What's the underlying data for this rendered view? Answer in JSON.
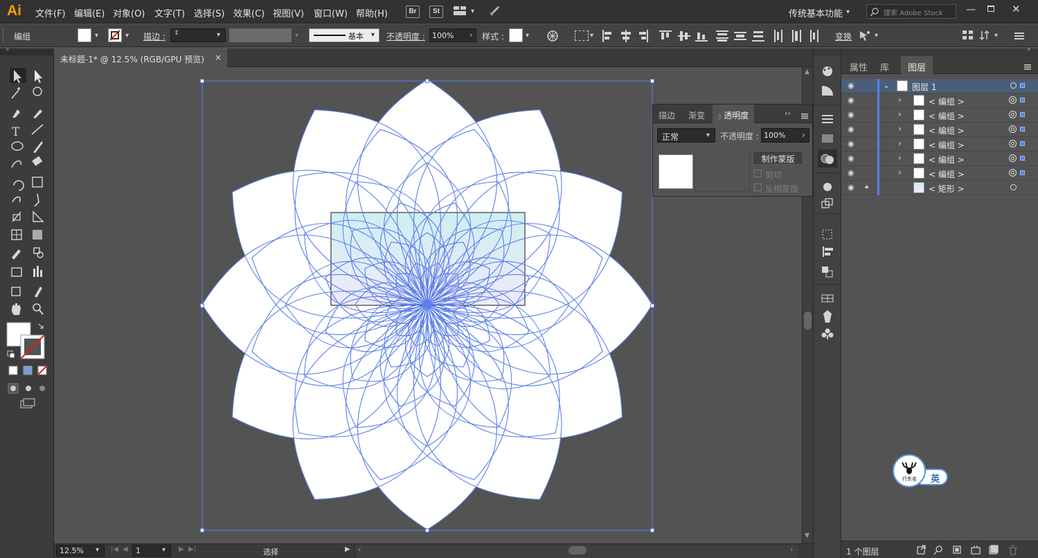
{
  "menubar": {
    "logo": "Ai",
    "items": [
      "文件(F)",
      "编辑(E)",
      "对象(O)",
      "文字(T)",
      "选择(S)",
      "效果(C)",
      "视图(V)",
      "窗口(W)",
      "帮助(H)"
    ],
    "bridge": "Br",
    "stock": "St",
    "workspace": "传统基本功能",
    "search_placeholder": "搜索 Adobe Stock"
  },
  "control_bar": {
    "selection_label": "编组",
    "stroke_label": "描边 :",
    "stroke_style": "基本",
    "opacity_label": "不透明度 :",
    "opacity_value": "100%",
    "style_label": "样式 :",
    "transform_label": "变换"
  },
  "document": {
    "tab_title": "未标题-1* @ 12.5% (RGB/GPU 预览)",
    "close": "×",
    "petal_count": 12,
    "colors": {
      "outline": "#5b7fe8",
      "petal_fill": "#ffffff",
      "canvas": "#535353",
      "selection": "#5b7fe8"
    }
  },
  "status": {
    "zoom": "12.5%",
    "page": "1",
    "tool": "选择"
  },
  "transparency_panel": {
    "tabs": [
      "描边",
      "渐变",
      "透明度"
    ],
    "active_tab": "透明度",
    "blend_mode": "正常",
    "opacity_label": "不透明度 :",
    "opacity_value": "100%",
    "make_mask": "制作蒙版",
    "clip": "剪切",
    "invert_mask": "反相蒙版"
  },
  "layers_panel": {
    "tabs": [
      "属性",
      "库",
      "图层"
    ],
    "active_tab": "图层",
    "rows": [
      {
        "name": "图层 1",
        "level": 0,
        "expanded": true
      },
      {
        "name": "< 编组 >",
        "level": 1
      },
      {
        "name": "< 编组 >",
        "level": 1
      },
      {
        "name": "< 编组 >",
        "level": 1
      },
      {
        "name": "< 编组 >",
        "level": 1
      },
      {
        "name": "< 编组 >",
        "level": 1
      },
      {
        "name": "< 编组 >",
        "level": 1
      },
      {
        "name": "< 矩形 >",
        "level": 1,
        "locked": true
      }
    ],
    "footer": "1 个图层"
  },
  "badge": {
    "text": "英",
    "logo_text": "行东名"
  }
}
